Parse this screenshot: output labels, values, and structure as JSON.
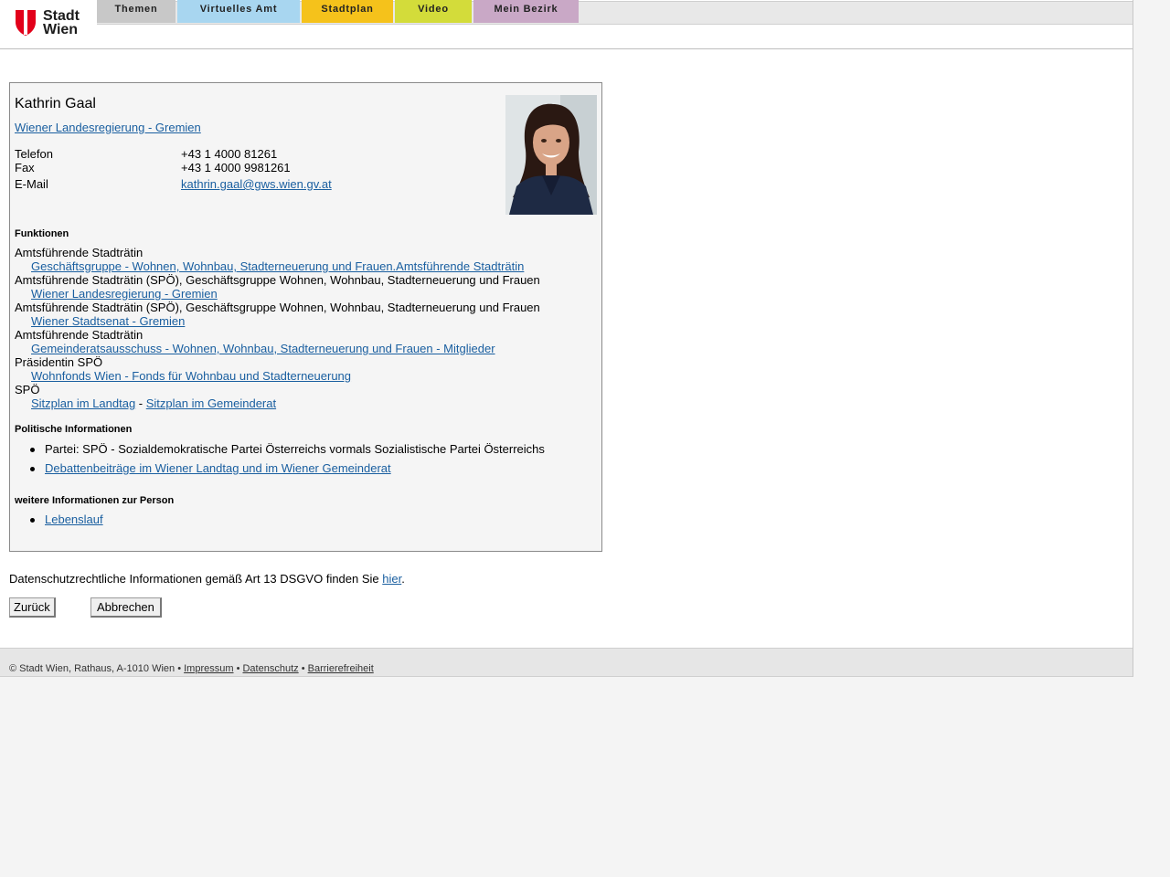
{
  "header": {
    "logo_text": [
      "Stadt",
      "Wien"
    ],
    "tabs": [
      {
        "label": "Themen",
        "color": "#c8c8c8"
      },
      {
        "label": "Virtuelles Amt",
        "color": "#a8d6f0"
      },
      {
        "label": "Stadtplan",
        "color": "#f5c21b"
      },
      {
        "label": "Video",
        "color": "#d3dc3a"
      },
      {
        "label": "Mein Bezirk",
        "color": "#c9a8c6"
      }
    ]
  },
  "person": {
    "name": "Kathrin Gaal",
    "group_link": "Wiener Landesregierung - Gremien ",
    "contacts": [
      {
        "label": "Telefon",
        "value": "+43 1 4000 81261"
      },
      {
        "label": "Fax",
        "value": "+43 1 4000 9981261"
      },
      {
        "label": "E-Mail",
        "value": "kathrin.gaal@gws.wien.gv.at"
      }
    ]
  },
  "funktionen": {
    "heading": "Funktionen",
    "items": [
      {
        "title": "Amtsführende Stadträtin",
        "link": "Geschäftsgruppe - Wohnen, Wohnbau, Stadterneuerung und Frauen.Amtsführende Stadträtin"
      },
      {
        "title": "Amtsführende Stadträtin (SPÖ), Geschäftsgruppe Wohnen, Wohnbau, Stadterneuerung und Frauen",
        "link": "Wiener Landesregierung - Gremien"
      },
      {
        "title": "Amtsführende Stadträtin (SPÖ), Geschäftsgruppe Wohnen, Wohnbau, Stadterneuerung und Frauen",
        "link": "Wiener Stadtsenat - Gremien"
      },
      {
        "title": "Amtsführende Stadträtin",
        "link": "Gemeinderatsausschuss - Wohnen, Wohnbau, Stadterneuerung und Frauen - Mitglieder"
      },
      {
        "title": "Präsidentin SPÖ",
        "link": "Wohnfonds Wien - Fonds für Wohnbau und Stadterneuerung"
      }
    ],
    "last": {
      "title": "SPÖ",
      "link1": "Sitzplan im Landtag",
      "sep": " - ",
      "link2": "Sitzplan im Gemeinderat"
    }
  },
  "politik": {
    "heading": "Politische Informationen",
    "partei": "Partei: SPÖ - Sozialdemokratische Partei Österreichs vormals Sozialistische Partei Österreichs",
    "debatten_link": "Debattenbeiträge im Wiener Landtag und im Wiener Gemeinderat"
  },
  "weitere": {
    "heading": "weitere Informationen zur Person",
    "link": "Lebenslauf"
  },
  "privacy": {
    "text": "Datenschutzrechtliche Informationen gemäß Art 13 DSGVO finden Sie ",
    "link": "hier",
    "end": "."
  },
  "buttons": {
    "back": "Zurück",
    "cancel": "Abbrechen"
  },
  "footer": {
    "copyright": "© Stadt Wien, Rathaus, A-1010 Wien",
    "sep": " • ",
    "links": [
      "Impressum",
      "Datenschutz",
      "Barrierefreiheit"
    ]
  }
}
